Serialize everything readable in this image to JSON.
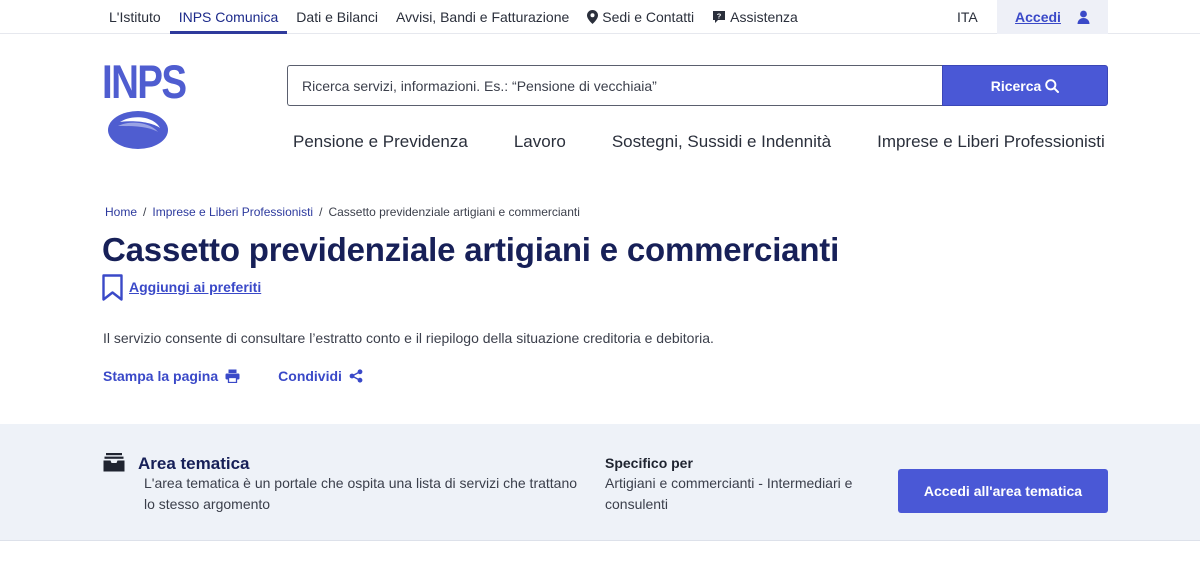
{
  "topnav": {
    "items": [
      {
        "label": "L'Istituto",
        "active": false
      },
      {
        "label": "INPS Comunica",
        "active": true
      },
      {
        "label": "Dati e Bilanci",
        "active": false
      },
      {
        "label": "Avvisi, Bandi e Fatturazione",
        "active": false
      },
      {
        "label": "Sedi e Contatti",
        "active": false
      },
      {
        "label": "Assistenza",
        "active": false
      }
    ],
    "language": "ITA",
    "login_label": "Accedi"
  },
  "header": {
    "logo_text": "INPS",
    "search_placeholder": "Ricerca servizi, informazioni. Es.: “Pensione di vecchiaia”",
    "search_button": "Ricerca"
  },
  "mainnav": {
    "items": [
      "Pensione e Previdenza",
      "Lavoro",
      "Sostegni, Sussidi e Indennità",
      "Imprese e Liberi Professionisti"
    ]
  },
  "breadcrumb": {
    "items": [
      "Home",
      "Imprese e Liberi Professionisti",
      "Cassetto previdenziale artigiani e commercianti"
    ],
    "separator": "/"
  },
  "page": {
    "title": "Cassetto previdenziale artigiani e commercianti",
    "favorite_label": "Aggiungi ai preferiti",
    "description": "Il servizio consente di consultare l’estratto conto e il riepilogo della situazione creditoria e debitoria.",
    "print_label": "Stampa la pagina",
    "share_label": "Condividi"
  },
  "area": {
    "title": "Area tematica",
    "description": "L'area tematica è un portale che ospita una lista di servizi che trattano lo stesso argomento",
    "specific_title": "Specifico per",
    "specific_value": "Artigiani e commercianti - Intermediari e consulenti",
    "button_label": "Accedi all'area tematica"
  },
  "colors": {
    "brand": "#4f5dd0",
    "primary_button": "#4a58d6",
    "title": "#172058",
    "link": "#3a49c8",
    "band_background": "#eef2f8"
  },
  "icons": {
    "sedi": "map-pin-icon",
    "assistenza": "chat-help-icon",
    "login": "user-icon",
    "search": "search-icon",
    "favorite": "bookmark-icon",
    "print": "printer-icon",
    "share": "share-icon",
    "area": "inbox-tray-icon"
  }
}
